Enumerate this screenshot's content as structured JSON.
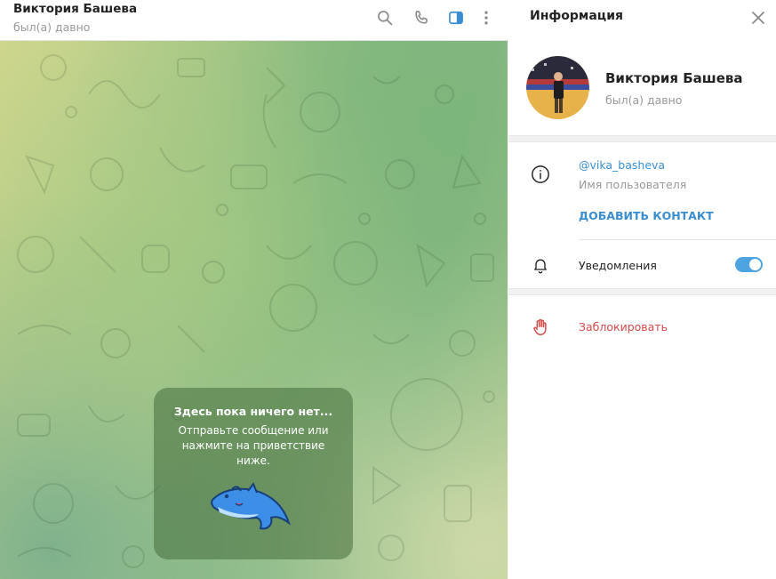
{
  "chat": {
    "peer_name": "Виктория Башева",
    "peer_status": "был(а) давно",
    "empty_title": "Здесь пока ничего нет...",
    "empty_text": "Отправьте сообщение или нажмите на приветствие ниже."
  },
  "info": {
    "title": "Информация",
    "name": "Виктория Башева",
    "status": "был(а) давно",
    "username": "@vika_basheva",
    "username_caption": "Имя пользователя",
    "add_contact": "ДОБАВИТЬ КОНТАКТ",
    "notifications_label": "Уведомления",
    "notifications_on": true,
    "block_label": "Заблокировать"
  },
  "colors": {
    "accent": "#3a8ed0",
    "danger": "#d14b4b",
    "toggle_on": "#4ea4e0"
  }
}
